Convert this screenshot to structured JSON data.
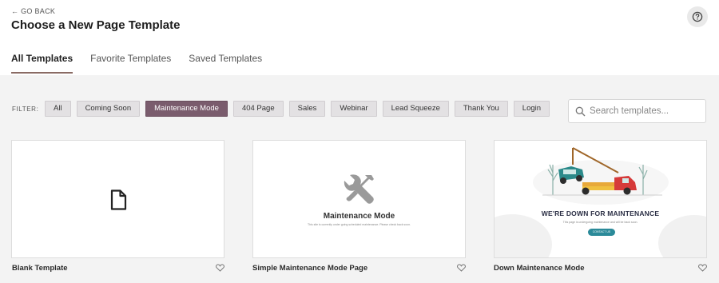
{
  "header": {
    "back_label": "← GO BACK",
    "title": "Choose a New Page Template",
    "help_icon": "question-circle-icon"
  },
  "tabs": [
    {
      "label": "All Templates",
      "active": true
    },
    {
      "label": "Favorite Templates",
      "active": false
    },
    {
      "label": "Saved Templates",
      "active": false
    }
  ],
  "filter": {
    "label": "FILTER:",
    "chips": [
      {
        "label": "All",
        "active": false
      },
      {
        "label": "Coming Soon",
        "active": false
      },
      {
        "label": "Maintenance Mode",
        "active": true
      },
      {
        "label": "404 Page",
        "active": false
      },
      {
        "label": "Sales",
        "active": false
      },
      {
        "label": "Webinar",
        "active": false
      },
      {
        "label": "Lead Squeeze",
        "active": false
      },
      {
        "label": "Thank You",
        "active": false
      },
      {
        "label": "Login",
        "active": false
      }
    ]
  },
  "search": {
    "placeholder": "Search templates...",
    "icon": "search-icon"
  },
  "templates": [
    {
      "name": "Blank Template",
      "icon": "document-icon"
    },
    {
      "name": "Simple Maintenance Mode Page",
      "preview_title": "Maintenance Mode",
      "preview_text": "This site is currently under going scheduled maintenance. Please check back soon.",
      "icon": "tools-icon"
    },
    {
      "name": "Down Maintenance Mode",
      "preview_title": "WE'RE DOWN FOR MAINTENANCE",
      "preview_text": "This page is undergoing maintenance and will be back soon.",
      "preview_button": "CONTACT US"
    }
  ],
  "colors": {
    "accent": "#7a5c6d",
    "tab_underline": "#8a6b64",
    "teal": "#2b8a99"
  }
}
